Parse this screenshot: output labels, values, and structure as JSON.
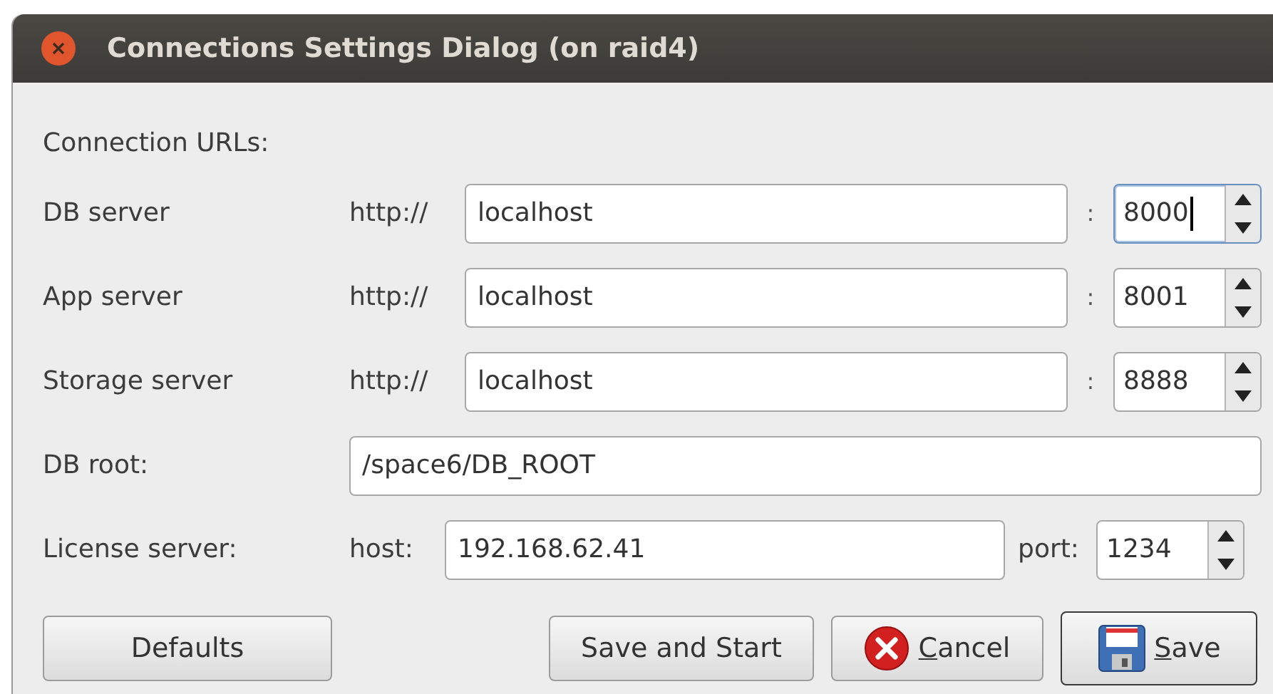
{
  "window": {
    "title": "Connections Settings Dialog (on raid4)"
  },
  "section_label": "Connection URLs:",
  "url_rows": [
    {
      "label": "DB server",
      "scheme": "http://",
      "host": "localhost",
      "separator": ":",
      "port": "8000",
      "focused": true
    },
    {
      "label": "App server",
      "scheme": "http://",
      "host": "localhost",
      "separator": ":",
      "port": "8001",
      "focused": false
    },
    {
      "label": "Storage server",
      "scheme": "http://",
      "host": "localhost",
      "separator": ":",
      "port": "8888",
      "focused": false
    }
  ],
  "db_root": {
    "label": "DB root:",
    "value": "/space6/DB_ROOT"
  },
  "license": {
    "label": "License server:",
    "host_label": "host:",
    "host": "192.168.62.41",
    "port_label": "port:",
    "port": "1234"
  },
  "buttons": [
    {
      "kind": "plain",
      "label": "Defaults",
      "mnemonic": false,
      "default": false
    },
    {
      "kind": "plain",
      "label": "Save and Start",
      "mnemonic": false,
      "default": false
    },
    {
      "kind": "cancel",
      "label": "Cancel",
      "mnemonic": true,
      "default": false
    },
    {
      "kind": "save",
      "label": "Save",
      "mnemonic": true,
      "default": true
    }
  ]
}
